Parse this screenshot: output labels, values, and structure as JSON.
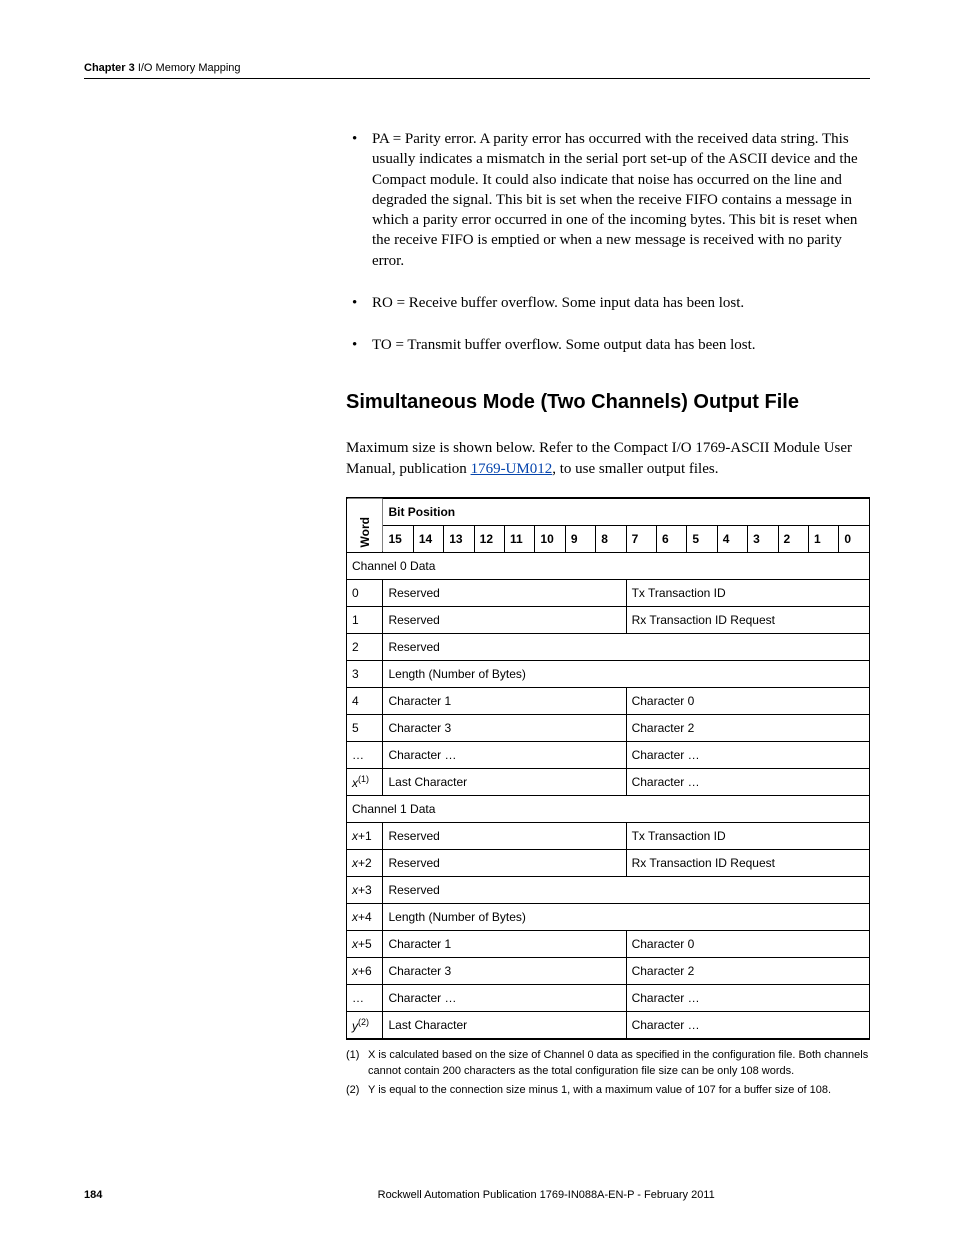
{
  "running_head": {
    "chapter": "Chapter 3",
    "title": "I/O Memory Mapping"
  },
  "bullets": {
    "pa": "PA = Parity error. A parity error has occurred with the received data string. This usually indicates a mismatch in the serial port set-up of the ASCII device and the Compact module. It could also indicate that noise has occurred on the line and degraded the signal. This bit is set when the receive FIFO contains a message in which a parity error occurred in one of the incoming bytes. This bit is reset when the receive FIFO is emptied or when a new message is received with no parity error.",
    "ro": "RO = Receive buffer overflow. Some input data has been lost.",
    "to": "TO = Transmit buffer overflow. Some output data has been lost."
  },
  "section_heading": "Simultaneous Mode (Two Channels) Output File",
  "intro": {
    "p1a": "Maximum size is shown below. Refer to the Compact I/O 1769-ASCII Module User Manual, publication ",
    "link": "1769-UM012",
    "p1b": ", to use smaller output files."
  },
  "table": {
    "vhead": "Word",
    "bithead": "Bit Position",
    "bits": [
      "15",
      "14",
      "13",
      "12",
      "11",
      "10",
      "9",
      "8",
      "7",
      "6",
      "5",
      "4",
      "3",
      "2",
      "1",
      "0"
    ],
    "ch0_label": "Channel 0 Data",
    "ch1_label": "Channel 1 Data",
    "words": {
      "w0": "0",
      "w1": "1",
      "w2": "2",
      "w3": "3",
      "w4": "4",
      "w5": "5",
      "wdots": "…",
      "wx": "x"
    },
    "words1": {
      "x1": "x",
      "p1": "+1",
      "x2": "x",
      "p2": "+2",
      "x3": "x",
      "p3": "+3",
      "x4": "x",
      "p4": "+4",
      "x5": "x",
      "p5": "+5",
      "x6": "x",
      "p6": "+6",
      "dots": "…",
      "y": "y"
    },
    "cells": {
      "reserved": "Reserved",
      "txid": "Tx Transaction ID",
      "rxreq": "Rx Transaction ID Request",
      "len": "Length (Number of Bytes)",
      "char0": "Character 0",
      "char1": "Character 1",
      "char2": "Character 2",
      "char3": "Character 3",
      "chardots": "Character …",
      "last": "Last Character"
    },
    "sup1": "(1)",
    "sup2": "(2)"
  },
  "footnotes": {
    "n1": "(1)",
    "t1": "X is calculated based on the size of Channel 0 data as specified in the configuration file. Both channels cannot contain 200 characters as the total configuration file size can be only 108 words.",
    "n2": "(2)",
    "t2": "Y is equal to the connection size minus 1, with a maximum value of 107 for a buffer size of 108."
  },
  "footer": {
    "page": "184",
    "text": "Rockwell Automation Publication 1769-IN088A-EN-P - February 2011"
  }
}
